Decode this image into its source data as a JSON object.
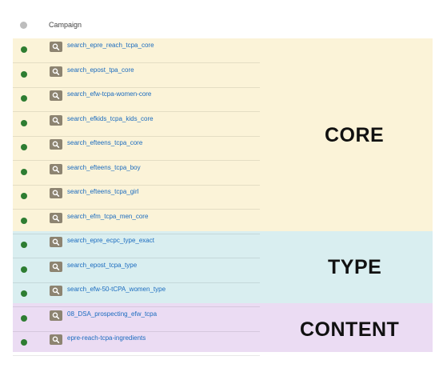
{
  "header": {
    "column_title": "Campaign"
  },
  "colors": {
    "core_bg": "#fbf3d8",
    "type_bg": "#d9eef0",
    "content_bg": "#ebdcf3",
    "enabled_dot": "#2e7d32",
    "header_dot": "#bdbdbd",
    "icon_bg": "#8d8471",
    "link": "#1a6bbf"
  },
  "sections": [
    {
      "name": "core",
      "label": "CORE"
    },
    {
      "name": "type",
      "label": "TYPE"
    },
    {
      "name": "content",
      "label": "CONTENT"
    }
  ],
  "campaigns": [
    {
      "name": "search_epre_reach_tcpa_core",
      "status": "enabled",
      "section": "core"
    },
    {
      "name": "search_epost_tpa_core",
      "status": "enabled",
      "section": "core"
    },
    {
      "name": "search_efw-tcpa-women-core",
      "status": "enabled",
      "section": "core"
    },
    {
      "name": "search_efkids_tcpa_kids_core",
      "status": "enabled",
      "section": "core"
    },
    {
      "name": "search_efteens_tcpa_core",
      "status": "enabled",
      "section": "core"
    },
    {
      "name": "search_efteens_tcpa_boy",
      "status": "enabled",
      "section": "core"
    },
    {
      "name": "search_efteens_tcpa_girl",
      "status": "enabled",
      "section": "core"
    },
    {
      "name": "search_efm_tcpa_men_core",
      "status": "enabled",
      "section": "core"
    },
    {
      "name": "search_epre_ecpc_type_exact",
      "status": "enabled",
      "section": "type"
    },
    {
      "name": "search_epost_tcpa_type",
      "status": "enabled",
      "section": "type"
    },
    {
      "name": "search_efw-50-tCPA_women_type",
      "status": "enabled",
      "section": "type"
    },
    {
      "name": "08_DSA_prospecting_efw_tcpa",
      "status": "enabled",
      "section": "content"
    },
    {
      "name": "epre-reach-tcpa-ingredients",
      "status": "enabled",
      "section": "content"
    }
  ]
}
